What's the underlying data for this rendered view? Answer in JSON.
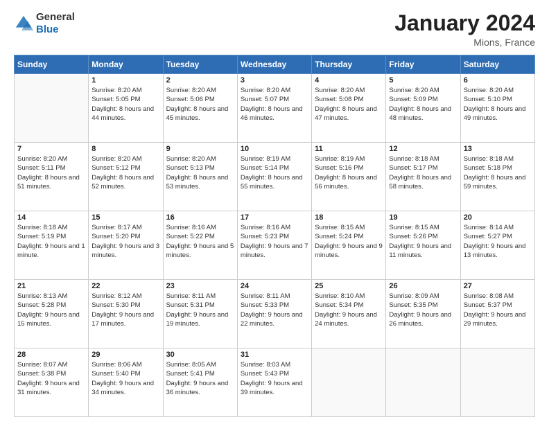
{
  "logo": {
    "general": "General",
    "blue": "Blue"
  },
  "title": {
    "main": "January 2024",
    "sub": "Mions, France"
  },
  "calendar": {
    "headers": [
      "Sunday",
      "Monday",
      "Tuesday",
      "Wednesday",
      "Thursday",
      "Friday",
      "Saturday"
    ],
    "rows": [
      [
        {
          "day": "",
          "sunrise": "",
          "sunset": "",
          "daylight": ""
        },
        {
          "day": "1",
          "sunrise": "Sunrise: 8:20 AM",
          "sunset": "Sunset: 5:05 PM",
          "daylight": "Daylight: 8 hours and 44 minutes."
        },
        {
          "day": "2",
          "sunrise": "Sunrise: 8:20 AM",
          "sunset": "Sunset: 5:06 PM",
          "daylight": "Daylight: 8 hours and 45 minutes."
        },
        {
          "day": "3",
          "sunrise": "Sunrise: 8:20 AM",
          "sunset": "Sunset: 5:07 PM",
          "daylight": "Daylight: 8 hours and 46 minutes."
        },
        {
          "day": "4",
          "sunrise": "Sunrise: 8:20 AM",
          "sunset": "Sunset: 5:08 PM",
          "daylight": "Daylight: 8 hours and 47 minutes."
        },
        {
          "day": "5",
          "sunrise": "Sunrise: 8:20 AM",
          "sunset": "Sunset: 5:09 PM",
          "daylight": "Daylight: 8 hours and 48 minutes."
        },
        {
          "day": "6",
          "sunrise": "Sunrise: 8:20 AM",
          "sunset": "Sunset: 5:10 PM",
          "daylight": "Daylight: 8 hours and 49 minutes."
        }
      ],
      [
        {
          "day": "7",
          "sunrise": "Sunrise: 8:20 AM",
          "sunset": "Sunset: 5:11 PM",
          "daylight": "Daylight: 8 hours and 51 minutes."
        },
        {
          "day": "8",
          "sunrise": "Sunrise: 8:20 AM",
          "sunset": "Sunset: 5:12 PM",
          "daylight": "Daylight: 8 hours and 52 minutes."
        },
        {
          "day": "9",
          "sunrise": "Sunrise: 8:20 AM",
          "sunset": "Sunset: 5:13 PM",
          "daylight": "Daylight: 8 hours and 53 minutes."
        },
        {
          "day": "10",
          "sunrise": "Sunrise: 8:19 AM",
          "sunset": "Sunset: 5:14 PM",
          "daylight": "Daylight: 8 hours and 55 minutes."
        },
        {
          "day": "11",
          "sunrise": "Sunrise: 8:19 AM",
          "sunset": "Sunset: 5:16 PM",
          "daylight": "Daylight: 8 hours and 56 minutes."
        },
        {
          "day": "12",
          "sunrise": "Sunrise: 8:18 AM",
          "sunset": "Sunset: 5:17 PM",
          "daylight": "Daylight: 8 hours and 58 minutes."
        },
        {
          "day": "13",
          "sunrise": "Sunrise: 8:18 AM",
          "sunset": "Sunset: 5:18 PM",
          "daylight": "Daylight: 8 hours and 59 minutes."
        }
      ],
      [
        {
          "day": "14",
          "sunrise": "Sunrise: 8:18 AM",
          "sunset": "Sunset: 5:19 PM",
          "daylight": "Daylight: 9 hours and 1 minute."
        },
        {
          "day": "15",
          "sunrise": "Sunrise: 8:17 AM",
          "sunset": "Sunset: 5:20 PM",
          "daylight": "Daylight: 9 hours and 3 minutes."
        },
        {
          "day": "16",
          "sunrise": "Sunrise: 8:16 AM",
          "sunset": "Sunset: 5:22 PM",
          "daylight": "Daylight: 9 hours and 5 minutes."
        },
        {
          "day": "17",
          "sunrise": "Sunrise: 8:16 AM",
          "sunset": "Sunset: 5:23 PM",
          "daylight": "Daylight: 9 hours and 7 minutes."
        },
        {
          "day": "18",
          "sunrise": "Sunrise: 8:15 AM",
          "sunset": "Sunset: 5:24 PM",
          "daylight": "Daylight: 9 hours and 9 minutes."
        },
        {
          "day": "19",
          "sunrise": "Sunrise: 8:15 AM",
          "sunset": "Sunset: 5:26 PM",
          "daylight": "Daylight: 9 hours and 11 minutes."
        },
        {
          "day": "20",
          "sunrise": "Sunrise: 8:14 AM",
          "sunset": "Sunset: 5:27 PM",
          "daylight": "Daylight: 9 hours and 13 minutes."
        }
      ],
      [
        {
          "day": "21",
          "sunrise": "Sunrise: 8:13 AM",
          "sunset": "Sunset: 5:28 PM",
          "daylight": "Daylight: 9 hours and 15 minutes."
        },
        {
          "day": "22",
          "sunrise": "Sunrise: 8:12 AM",
          "sunset": "Sunset: 5:30 PM",
          "daylight": "Daylight: 9 hours and 17 minutes."
        },
        {
          "day": "23",
          "sunrise": "Sunrise: 8:11 AM",
          "sunset": "Sunset: 5:31 PM",
          "daylight": "Daylight: 9 hours and 19 minutes."
        },
        {
          "day": "24",
          "sunrise": "Sunrise: 8:11 AM",
          "sunset": "Sunset: 5:33 PM",
          "daylight": "Daylight: 9 hours and 22 minutes."
        },
        {
          "day": "25",
          "sunrise": "Sunrise: 8:10 AM",
          "sunset": "Sunset: 5:34 PM",
          "daylight": "Daylight: 9 hours and 24 minutes."
        },
        {
          "day": "26",
          "sunrise": "Sunrise: 8:09 AM",
          "sunset": "Sunset: 5:35 PM",
          "daylight": "Daylight: 9 hours and 26 minutes."
        },
        {
          "day": "27",
          "sunrise": "Sunrise: 8:08 AM",
          "sunset": "Sunset: 5:37 PM",
          "daylight": "Daylight: 9 hours and 29 minutes."
        }
      ],
      [
        {
          "day": "28",
          "sunrise": "Sunrise: 8:07 AM",
          "sunset": "Sunset: 5:38 PM",
          "daylight": "Daylight: 9 hours and 31 minutes."
        },
        {
          "day": "29",
          "sunrise": "Sunrise: 8:06 AM",
          "sunset": "Sunset: 5:40 PM",
          "daylight": "Daylight: 9 hours and 34 minutes."
        },
        {
          "day": "30",
          "sunrise": "Sunrise: 8:05 AM",
          "sunset": "Sunset: 5:41 PM",
          "daylight": "Daylight: 9 hours and 36 minutes."
        },
        {
          "day": "31",
          "sunrise": "Sunrise: 8:03 AM",
          "sunset": "Sunset: 5:43 PM",
          "daylight": "Daylight: 9 hours and 39 minutes."
        },
        {
          "day": "",
          "sunrise": "",
          "sunset": "",
          "daylight": ""
        },
        {
          "day": "",
          "sunrise": "",
          "sunset": "",
          "daylight": ""
        },
        {
          "day": "",
          "sunrise": "",
          "sunset": "",
          "daylight": ""
        }
      ]
    ]
  }
}
